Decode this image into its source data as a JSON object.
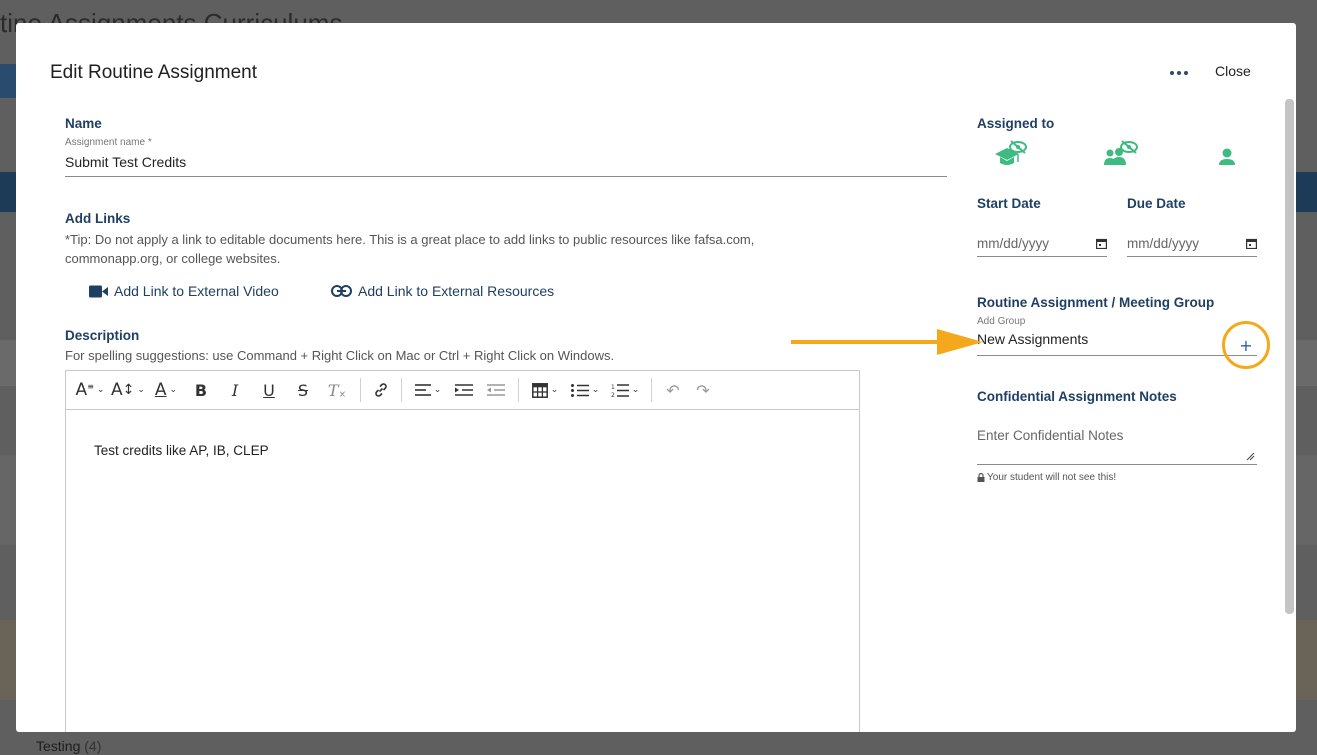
{
  "background": {
    "page_title": "tine Assignments Curriculums",
    "testing_label": "Testing",
    "testing_count": "(4)"
  },
  "modal": {
    "title": "Edit Routine Assignment",
    "close_label": "Close",
    "more_icon": "more-horizontal-icon"
  },
  "name_section": {
    "label": "Name",
    "field_label": "Assignment name *",
    "value": "Submit Test Credits"
  },
  "links_section": {
    "label": "Add Links",
    "tip_line1": "*Tip: Do not apply a link to editable documents here. This is a great place to add links to public resources like fafsa.com,",
    "tip_line2": "commonapp.org, or college websites.",
    "video_button": "Add Link to External Video",
    "resources_button": "Add Link to External Resources"
  },
  "description_section": {
    "label": "Description",
    "help": "For spelling suggestions: use Command + Right Click on Mac or Ctrl + Right Click on Windows.",
    "content": "Test credits like AP, IB, CLEP"
  },
  "toolbar": {
    "font_style": "A",
    "font_size": "A",
    "font_color": "A",
    "bold": "B",
    "italic": "I",
    "underline": "U",
    "strikethrough": "S",
    "clear_format": "T"
  },
  "right_panel": {
    "assigned_label": "Assigned to",
    "start_date_label": "Start Date",
    "due_date_label": "Due Date",
    "start_date_placeholder": "mm/dd/yyyy",
    "due_date_placeholder": "mm/dd/yyyy",
    "group_label": "Routine Assignment / Meeting Group",
    "group_field_label": "Add Group",
    "group_value": "New Assignments",
    "add_group_symbol": "+",
    "notes_label": "Confidential Assignment Notes",
    "notes_placeholder": "Enter Confidential Notes",
    "notes_hint": "Your student will not see this!"
  },
  "colors": {
    "accent_navy": "#1f3f63",
    "assign_green": "#3dbb80",
    "highlight_orange": "#f6a81c"
  }
}
